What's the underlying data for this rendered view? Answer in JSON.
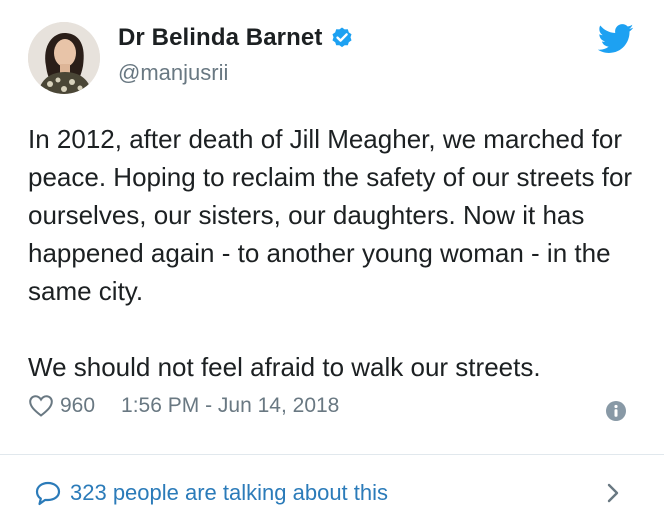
{
  "author": {
    "display_name": "Dr Belinda Barnet",
    "handle": "@manjusrii",
    "verified": true
  },
  "tweet": {
    "paragraphs": [
      "In 2012, after death of Jill Meagher, we marched for peace. Hoping to reclaim the safety of our streets for ourselves, our sisters, our daughters. Now it has happened again - to another young woman - in the same city.",
      "We should not feel afraid to walk our streets."
    ],
    "like_count": "960",
    "timestamp": "1:56 PM - Jun 14, 2018"
  },
  "conversation": {
    "label": "323 people are talking about this"
  },
  "icons": {
    "brand": "twitter-bird-icon",
    "verified": "verified-badge-icon",
    "like": "heart-icon",
    "info": "info-icon",
    "conversation": "speech-bubble-icon",
    "more": "chevron-right-icon"
  },
  "colors": {
    "brand_blue": "#1da1f2",
    "link_blue": "#2b7bb9",
    "text": "#1c2022",
    "secondary_text": "#697882",
    "divider": "#e1e8ed",
    "info_icon": "#8899a6"
  }
}
